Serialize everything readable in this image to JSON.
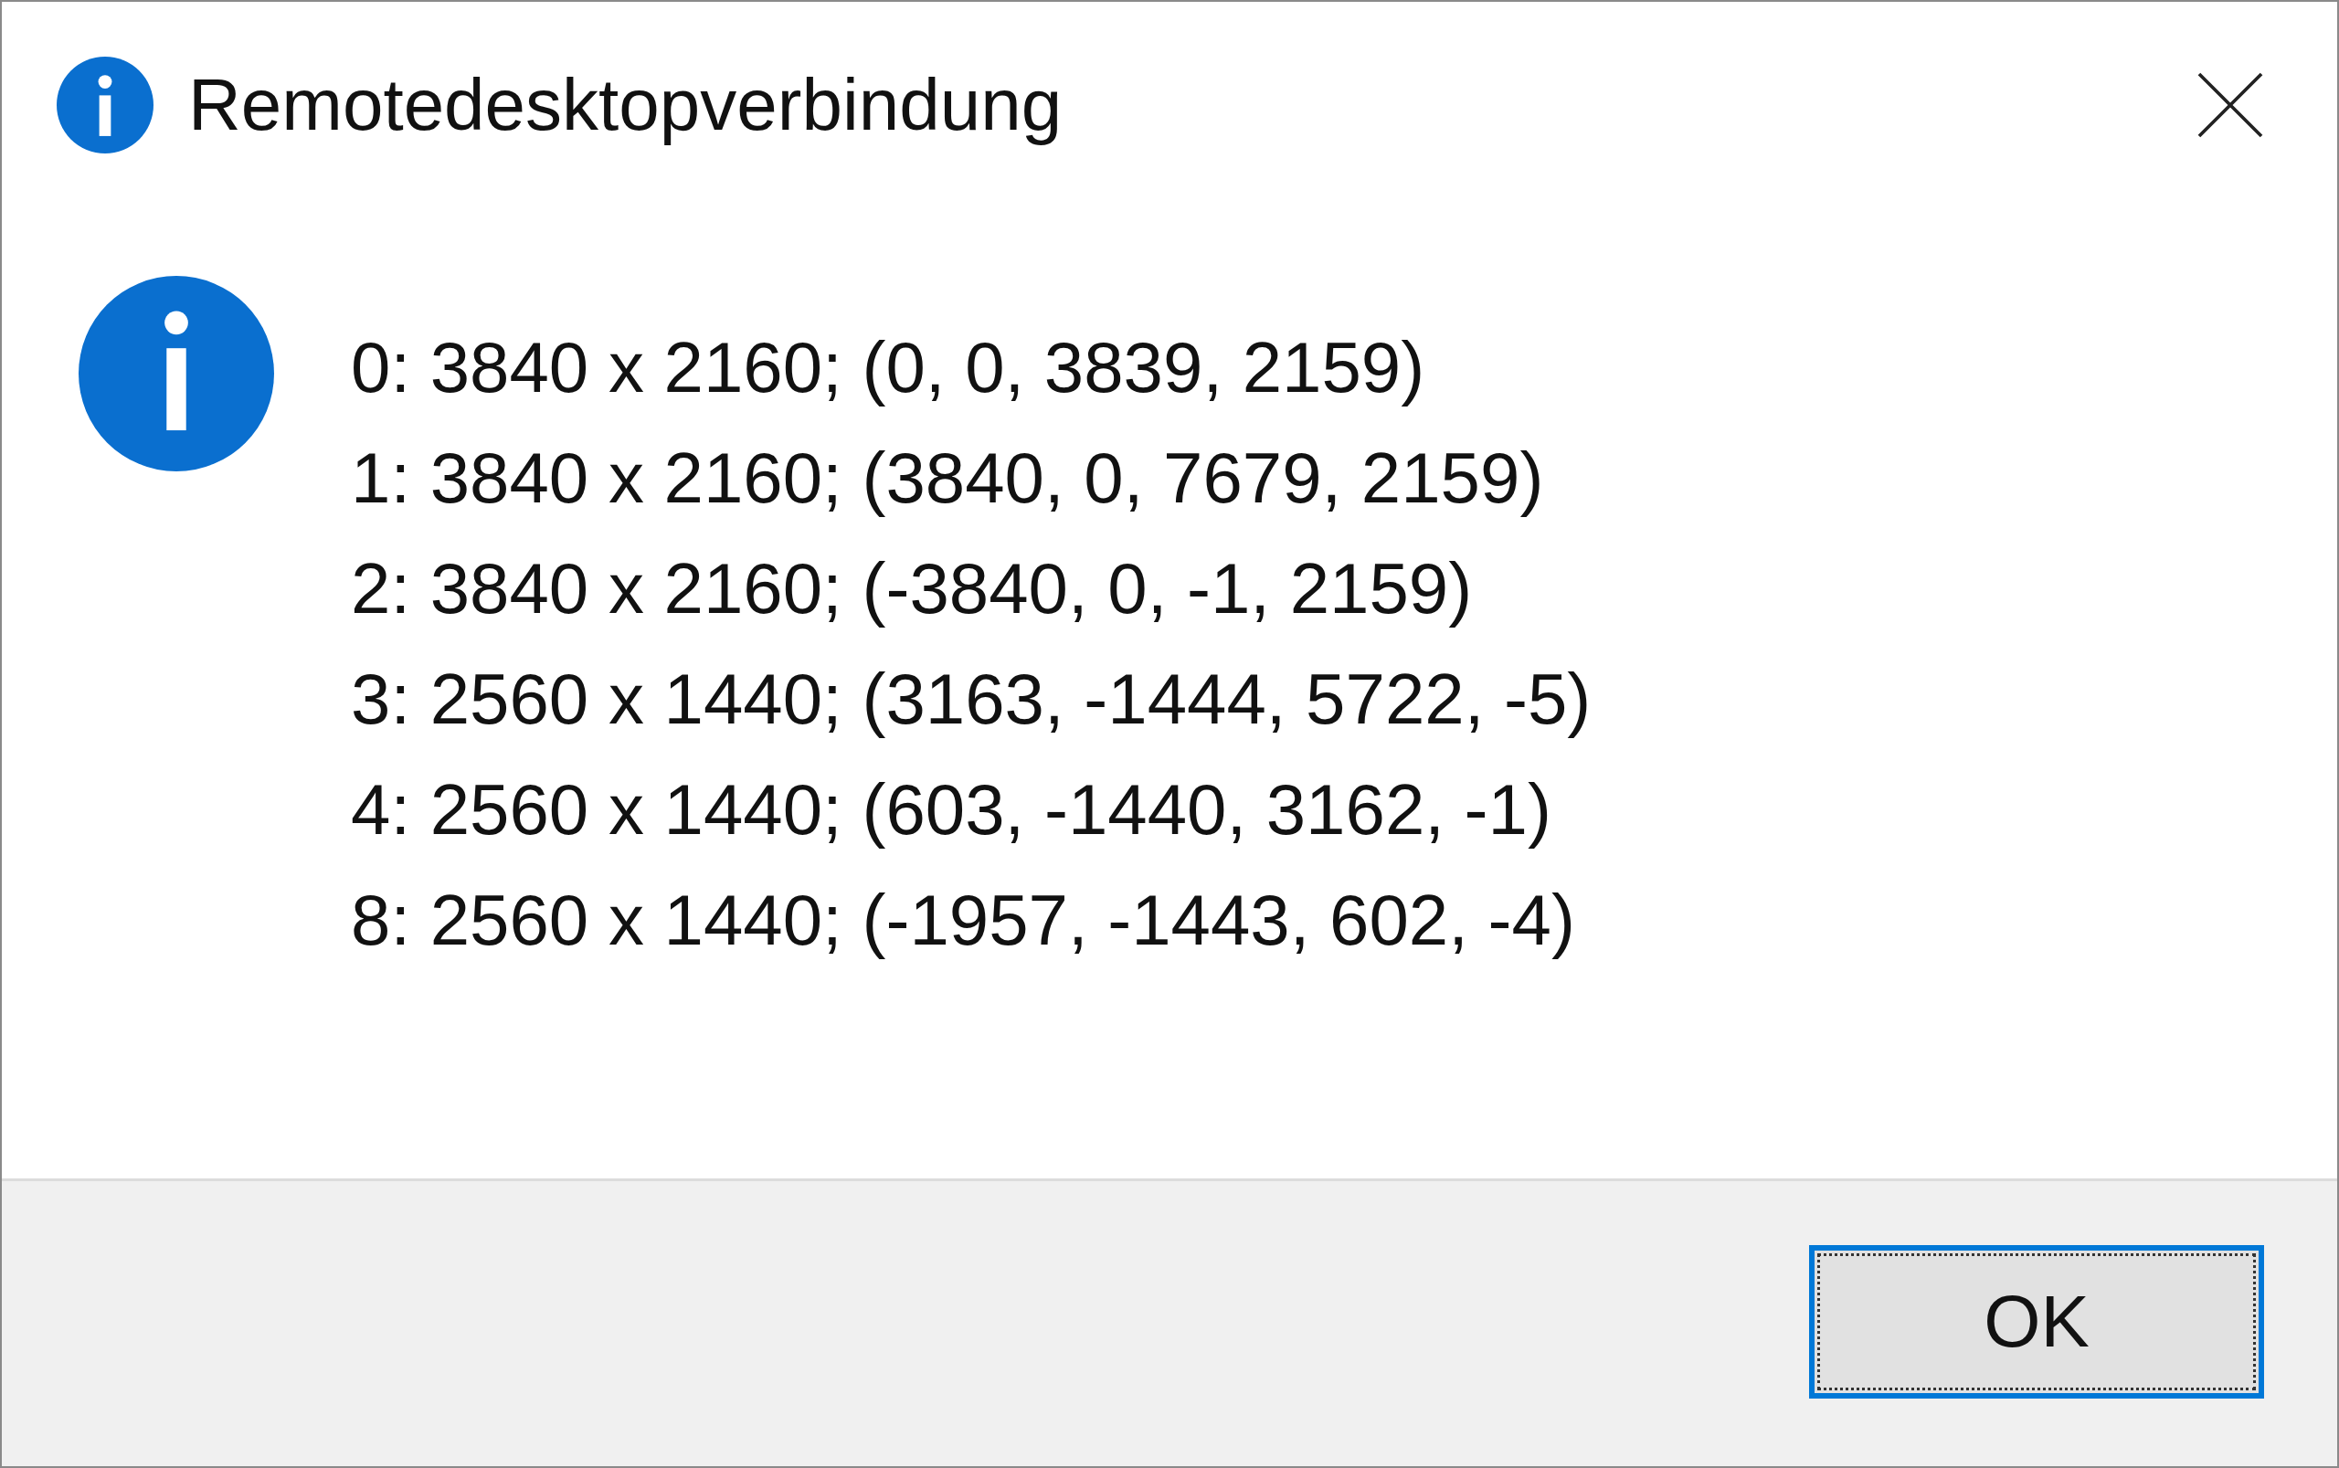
{
  "window": {
    "title": "Remotedesktopverbindung"
  },
  "message": {
    "lines": [
      "0: 3840 x 2160; (0, 0, 3839, 2159)",
      "1: 3840 x 2160; (3840, 0, 7679, 2159)",
      "2: 3840 x 2160; (-3840, 0, -1, 2159)",
      "3: 2560 x 1440; (3163, -1444, 5722, -5)",
      "4: 2560 x 1440; (603, -1440, 3162, -1)",
      "8: 2560 x 1440; (-1957, -1443, 602, -4)"
    ]
  },
  "buttons": [
    {
      "label": "OK",
      "focused": true
    }
  ]
}
